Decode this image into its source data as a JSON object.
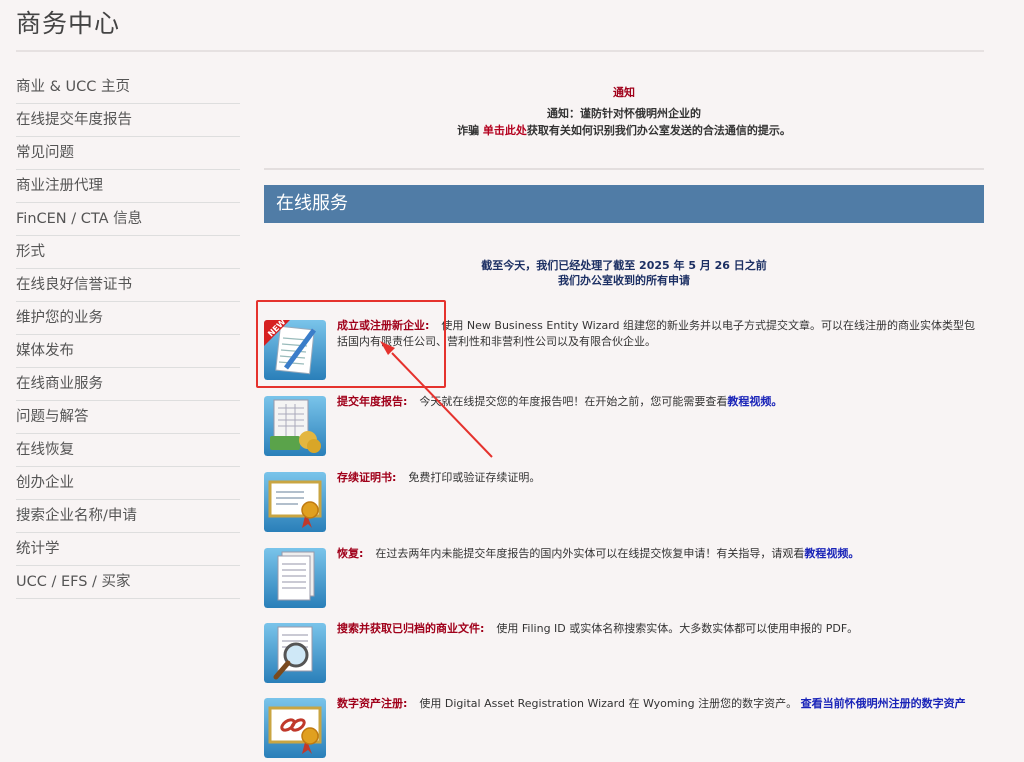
{
  "page": {
    "title": "商务中心"
  },
  "sidebar": {
    "items": [
      {
        "label": "商业 & UCC 主页"
      },
      {
        "label": "在线提交年度报告"
      },
      {
        "label": "常见问题"
      },
      {
        "label": "商业注册代理"
      },
      {
        "label": "FinCEN / CTA 信息"
      },
      {
        "label": "形式"
      },
      {
        "label": "在线良好信誉证书"
      },
      {
        "label": "维护您的业务"
      },
      {
        "label": "媒体发布"
      },
      {
        "label": "在线商业服务"
      },
      {
        "label": "问题与解答"
      },
      {
        "label": "在线恢复"
      },
      {
        "label": "创办企业"
      },
      {
        "label": "搜索企业名称/申请"
      },
      {
        "label": "统计学"
      },
      {
        "label": "UCC / EFS / 买家"
      }
    ]
  },
  "notice": {
    "title": "通知",
    "line1": "通知：谨防针对怀俄明州企业的",
    "line2_prefix": "诈骗",
    "line2_link": "单击此处",
    "line2_suffix": "获取有关如何识别我们办公室发送的合法通信的提示。"
  },
  "section": {
    "header": "在线服务"
  },
  "processed": {
    "line1": "截至今天，我们已经处理了截至 2025 年 5 月 26 日之前",
    "line2": "我们办公室收到的所有申请"
  },
  "services": [
    {
      "icon": "new-document-icon",
      "name": "成立或注册新企业:",
      "desc": "使用 New Business Entity Wizard 组建您的新业务并以电子方式提交文章。可以在线注册的商业实体类型包括国内有限责任公司、营利性和非营利性公司以及有限合伙企业。",
      "link": ""
    },
    {
      "icon": "annual-report-icon",
      "name": "提交年度报告:",
      "desc": "今天就在线提交您的年度报告吧！在开始之前，您可能需要查看",
      "link": "教程视频。"
    },
    {
      "icon": "certificate-icon",
      "name": "存续证明书:",
      "desc": "免费打印或验证存续证明。",
      "link": ""
    },
    {
      "icon": "reinstatement-icon",
      "name": "恢复:",
      "desc": "在过去两年内未能提交年度报告的国内外实体可以在线提交恢复申请！有关指导，请观看",
      "link": "教程视频。"
    },
    {
      "icon": "search-documents-icon",
      "name": "搜索并获取已归档的商业文件:",
      "desc": "使用 Filing ID 或实体名称搜索实体。大多数实体都可以使用申报的 PDF。",
      "link": ""
    },
    {
      "icon": "digital-asset-icon",
      "name": "数字资产注册:",
      "desc": "使用 Digital Asset Registration Wizard 在 Wyoming 注册您的数字资产。",
      "link": "查看当前怀俄明州注册的数字资产"
    }
  ],
  "colors": {
    "header_bg": "#507ca6",
    "service_name": "#a0001a",
    "link_blue": "#1a24b8",
    "annotation": "#e5322d"
  }
}
